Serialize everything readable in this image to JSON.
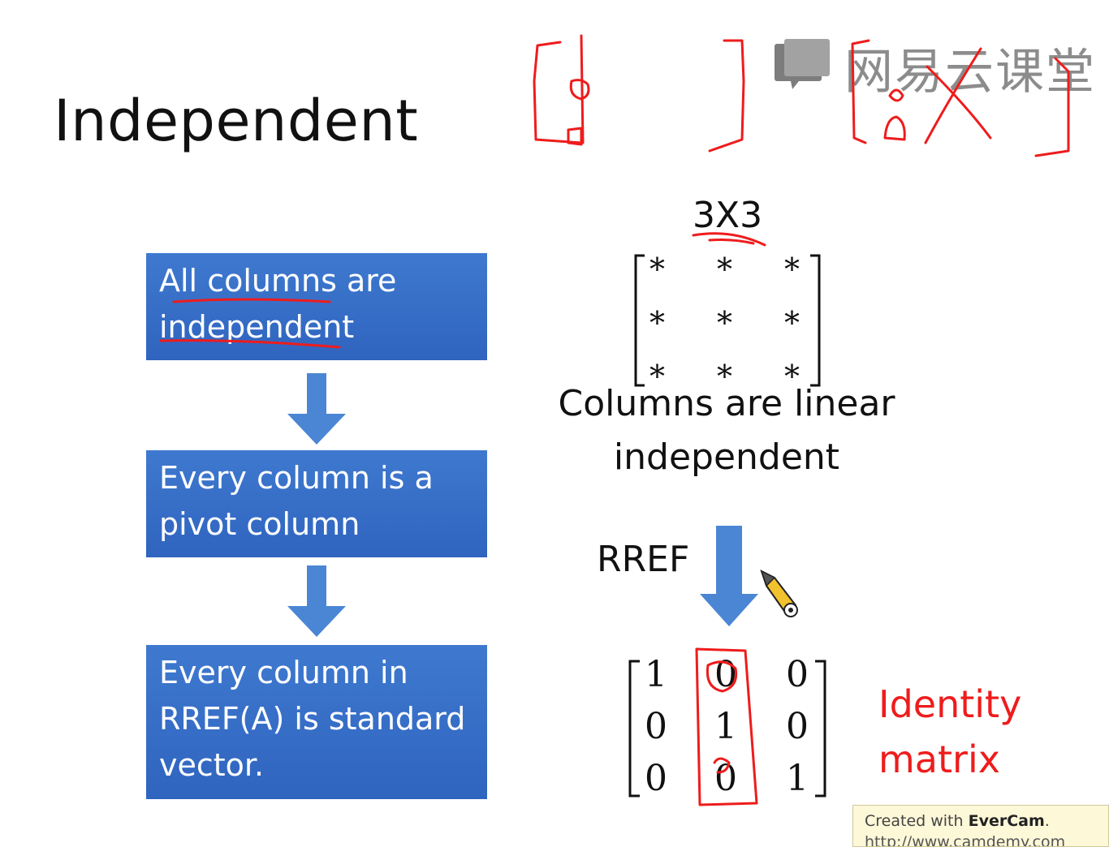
{
  "slide": {
    "title": "Independent",
    "boxes": [
      {
        "lines": [
          "All columns are",
          "independent"
        ]
      },
      {
        "lines": [
          "Every column is a",
          "pivot column"
        ]
      },
      {
        "lines": [
          "Every column in",
          "RREF(A) is standard",
          "vector."
        ]
      }
    ],
    "matrix_size_label": "3X3",
    "star_matrix": [
      "*",
      "*",
      "*",
      "*",
      "*",
      "*",
      "*",
      "*",
      "*"
    ],
    "caption_line1": "Columns are linear",
    "caption_line2": "independent",
    "rref_label": "RREF",
    "identity_matrix": [
      "1",
      "0",
      "0",
      "0",
      "1",
      "0",
      "0",
      "0",
      "1"
    ],
    "annotation_line1": "Identity",
    "annotation_line2": "matrix"
  },
  "watermark": {
    "text": "网易云课堂"
  },
  "overlay": {
    "created_with": "Created with",
    "brand": "EverCam",
    "url": "http://www.camdemy.com"
  },
  "colors": {
    "box_blue": "#3469c6",
    "arrow_blue": "#4a86d4",
    "annotation_red": "#ee1c1c",
    "watermark_gray": "#8c8c8c"
  }
}
